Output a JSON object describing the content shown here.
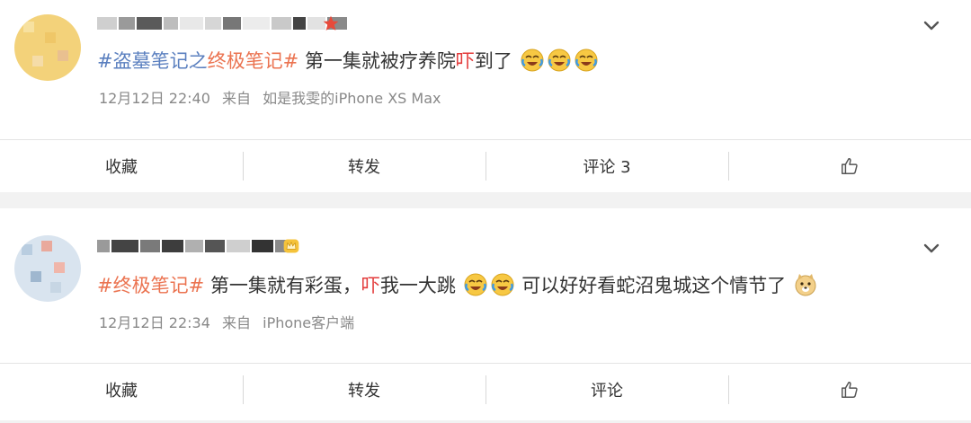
{
  "posts": [
    {
      "hashtag_1_part_a": "#盗墓笔记之",
      "hashtag_1_part_b": "终极笔记#",
      "text_before_red": " 第一集就被疗养院",
      "text_red": "吓",
      "text_after_red": "到了",
      "emoji": [
        "laughing-crying-emoji",
        "laughing-crying-emoji",
        "laughing-crying-emoji"
      ],
      "date": "12月12日 22:40",
      "source_prefix": "来自",
      "source": "如是我雯的iPhone XS Max",
      "badge": "red-star-badge",
      "actions": {
        "favorite": "收藏",
        "repost": "转发",
        "comment": "评论 3"
      }
    },
    {
      "hashtag": "#终极笔记#",
      "text_before_red": " 第一集就有彩蛋，",
      "text_red": "吓",
      "text_after_red": "我一大跳",
      "text_after_emoji": " 可以好好看蛇沼鬼城这个情节了",
      "date": "12月12日 22:34",
      "source_prefix": "来自",
      "source": "iPhone客户端",
      "badge": "yellow-crown-badge",
      "actions": {
        "favorite": "收藏",
        "repost": "转发",
        "comment": "评论"
      }
    }
  ],
  "colors": {
    "hashtag_orange": "#eb7350",
    "hashtag_blue": "#5a7fbf",
    "highlight_red": "#e33a3a",
    "meta_gray": "#888888"
  }
}
